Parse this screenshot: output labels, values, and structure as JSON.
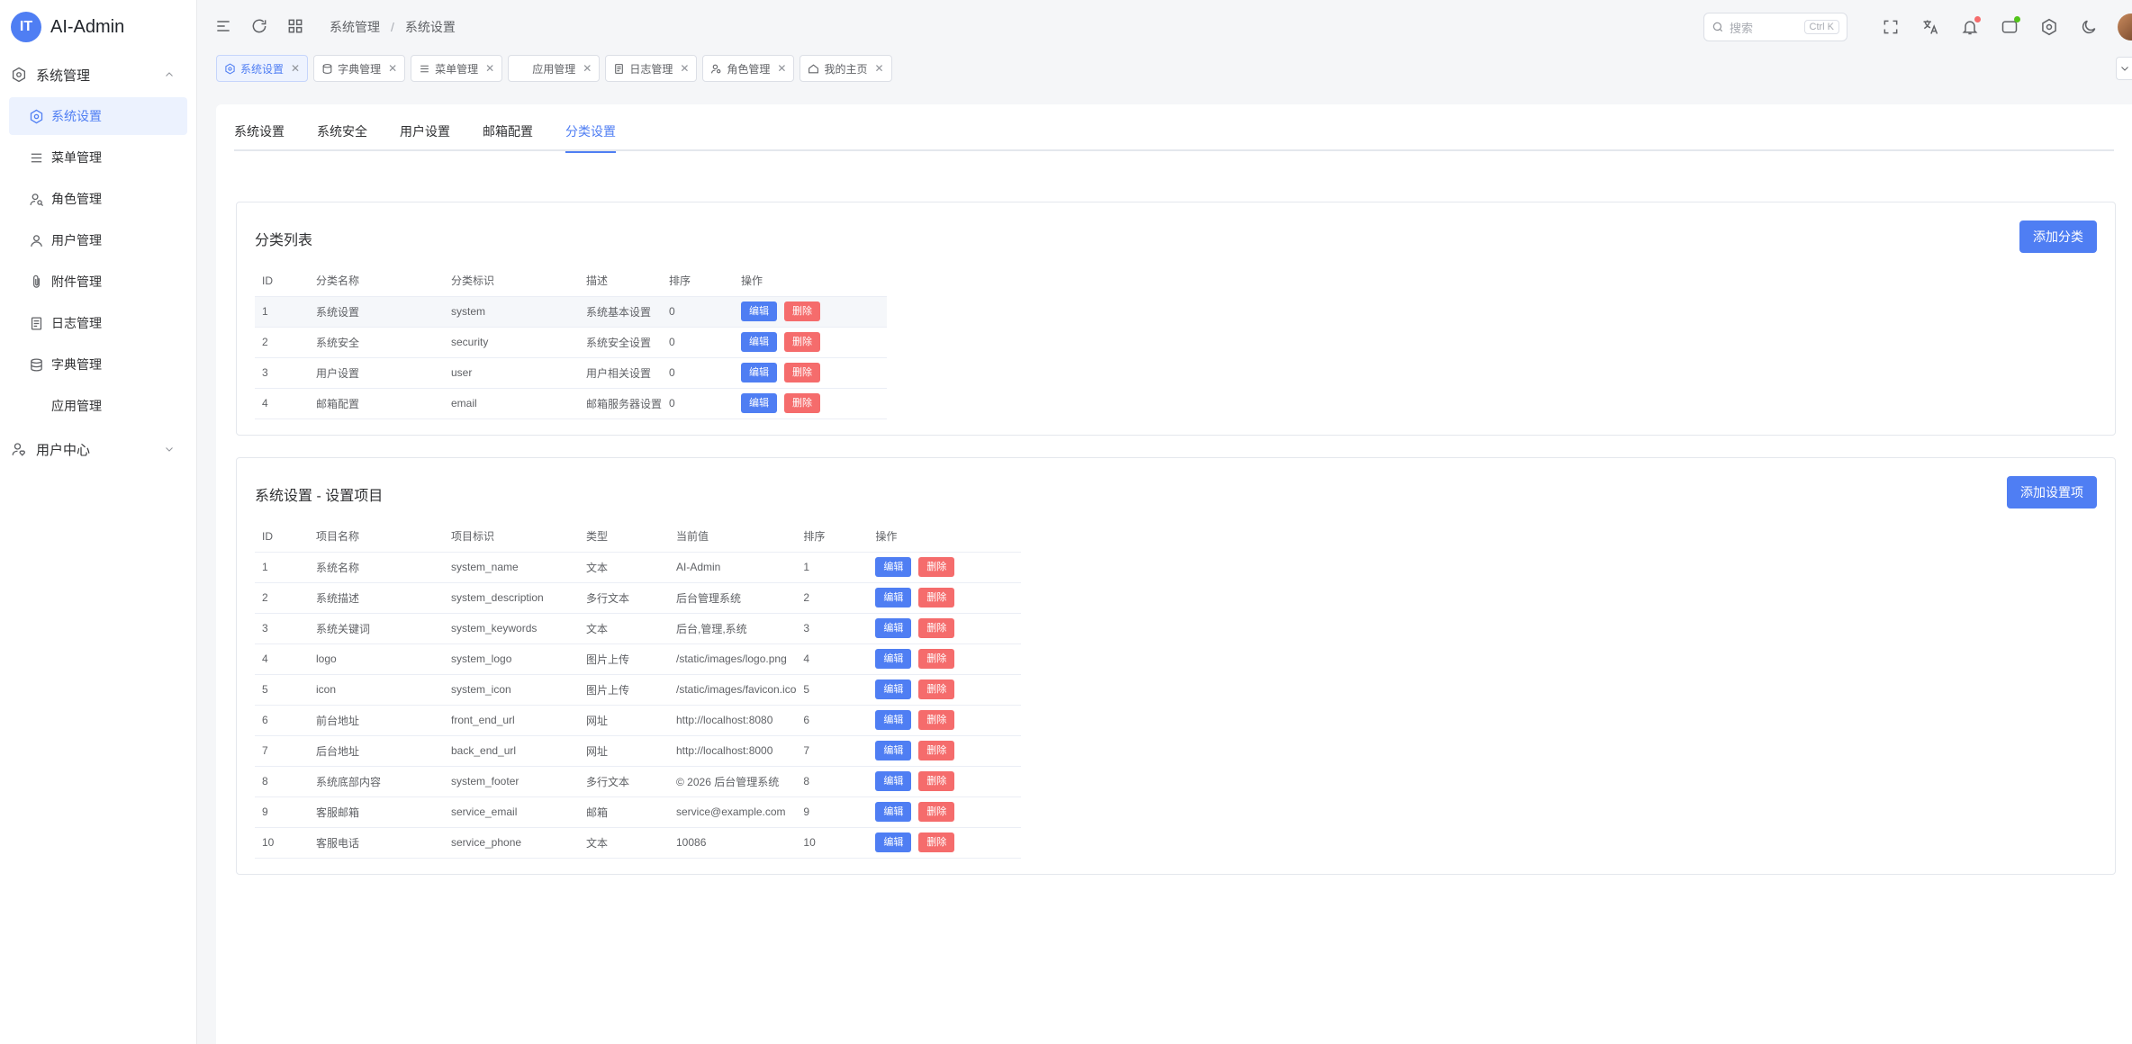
{
  "app": {
    "title": "AI-Admin",
    "logo_text": "IT"
  },
  "sidebar": {
    "groups": [
      {
        "label": "系统管理",
        "expanded": true,
        "items": [
          {
            "label": "系统设置",
            "icon": "gear-icon",
            "active": true
          },
          {
            "label": "菜单管理",
            "icon": "menu-icon"
          },
          {
            "label": "角色管理",
            "icon": "role-icon"
          },
          {
            "label": "用户管理",
            "icon": "user-icon"
          },
          {
            "label": "附件管理",
            "icon": "paperclip-icon"
          },
          {
            "label": "日志管理",
            "icon": "document-icon"
          },
          {
            "label": "字典管理",
            "icon": "database-icon"
          },
          {
            "label": "应用管理",
            "icon": ""
          }
        ]
      },
      {
        "label": "用户中心",
        "expanded": false,
        "items": []
      }
    ]
  },
  "header": {
    "breadcrumb": [
      "系统管理",
      "系统设置"
    ],
    "search": {
      "placeholder": "搜索",
      "shortcut": "Ctrl K"
    }
  },
  "tags": [
    {
      "label": "系统设置",
      "icon": "gear-icon",
      "active": true,
      "closable": true
    },
    {
      "label": "字典管理",
      "icon": "database-icon",
      "closable": true
    },
    {
      "label": "菜单管理",
      "icon": "menu-icon",
      "closable": true
    },
    {
      "label": "应用管理",
      "icon": "",
      "closable": true
    },
    {
      "label": "日志管理",
      "icon": "document-icon",
      "closable": true
    },
    {
      "label": "角色管理",
      "icon": "role-icon",
      "closable": true
    },
    {
      "label": "我的主页",
      "icon": "home-icon",
      "closable": true
    }
  ],
  "subtabs": [
    "系统设置",
    "系统安全",
    "用户设置",
    "邮箱配置",
    "分类设置"
  ],
  "active_subtab": "分类设置",
  "category_card": {
    "title": "分类列表",
    "add_button": "添加分类",
    "columns": [
      "ID",
      "分类名称",
      "分类标识",
      "描述",
      "排序",
      "操作"
    ],
    "rows": [
      [
        "1",
        "系统设置",
        "system",
        "系统基本设置",
        "0"
      ],
      [
        "2",
        "系统安全",
        "security",
        "系统安全设置",
        "0"
      ],
      [
        "3",
        "用户设置",
        "user",
        "用户相关设置",
        "0"
      ],
      [
        "4",
        "邮箱配置",
        "email",
        "邮箱服务器设置",
        "0"
      ]
    ]
  },
  "settings_card": {
    "title": "系统设置 - 设置项目",
    "add_button": "添加设置项",
    "columns": [
      "ID",
      "项目名称",
      "项目标识",
      "类型",
      "当前值",
      "排序",
      "操作"
    ],
    "rows": [
      [
        "1",
        "系统名称",
        "system_name",
        "文本",
        "AI-Admin",
        "1"
      ],
      [
        "2",
        "系统描述",
        "system_description",
        "多行文本",
        "后台管理系统",
        "2"
      ],
      [
        "3",
        "系统关键词",
        "system_keywords",
        "文本",
        "后台,管理,系统",
        "3"
      ],
      [
        "4",
        "logo",
        "system_logo",
        "图片上传",
        "/static/images/logo.png",
        "4"
      ],
      [
        "5",
        "icon",
        "system_icon",
        "图片上传",
        "/static/images/favicon.ico",
        "5"
      ],
      [
        "6",
        "前台地址",
        "front_end_url",
        "网址",
        "http://localhost:8080",
        "6"
      ],
      [
        "7",
        "后台地址",
        "back_end_url",
        "网址",
        "http://localhost:8000",
        "7"
      ],
      [
        "8",
        "系统底部内容",
        "system_footer",
        "多行文本",
        "© 2026 后台管理系统",
        "8"
      ],
      [
        "9",
        "客服邮箱",
        "service_email",
        "邮箱",
        "service@example.com",
        "9"
      ],
      [
        "10",
        "客服电话",
        "service_phone",
        "文本",
        "10086",
        "10"
      ]
    ]
  },
  "row_actions": {
    "edit": "编辑",
    "delete": "删除"
  },
  "colors": {
    "primary": "#4f7ef3",
    "danger": "#f56c6c",
    "active_bg": "#ecf2fe"
  }
}
